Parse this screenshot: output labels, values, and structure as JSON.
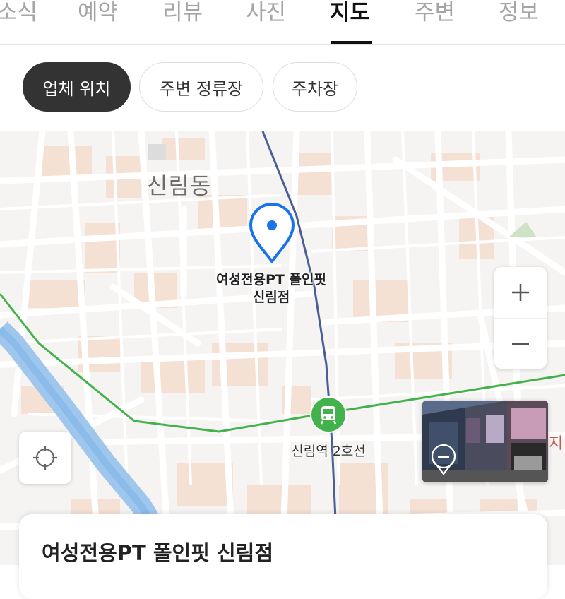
{
  "tabs": [
    {
      "label": "소식"
    },
    {
      "label": "예약"
    },
    {
      "label": "리뷰"
    },
    {
      "label": "사진"
    },
    {
      "label": "지도",
      "active": true
    },
    {
      "label": "주변"
    },
    {
      "label": "정보"
    }
  ],
  "chips": [
    {
      "label": "업체 위치",
      "active": true
    },
    {
      "label": "주변 정류장"
    },
    {
      "label": "주차장"
    }
  ],
  "map": {
    "area_label": "신림동",
    "place_label_line1": "여성전용PT 폴인핏",
    "place_label_line2": "신림점",
    "station_label": "신림역 2호선",
    "edge_label": "지",
    "zoom_in_symbol": "+",
    "zoom_out_symbol": "−",
    "colors": {
      "pin": "#1a73e8",
      "line2_green": "#3fb04a",
      "rail_blue": "#4a63a0",
      "stream": "#7fb7e6",
      "block_pink": "#f6e1d6"
    }
  },
  "card": {
    "title": "여성전용PT 폴인핏 신림점"
  }
}
